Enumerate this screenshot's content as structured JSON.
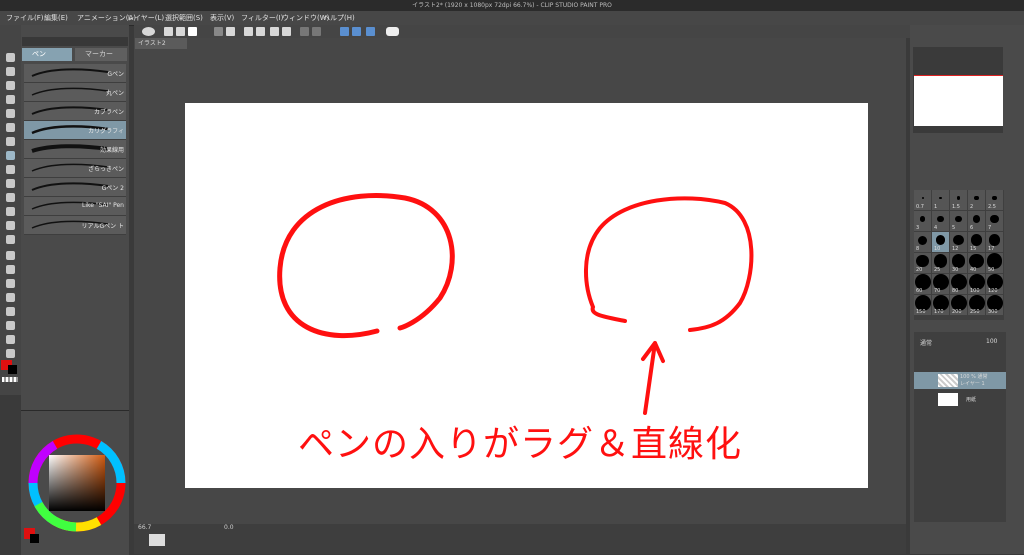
{
  "window": {
    "title": "イラスト2* (1920 x 1080px 72dpi 66.7%) - CLIP STUDIO PAINT PRO"
  },
  "menu": [
    {
      "label": "ファイル(F)"
    },
    {
      "label": "編集(E)"
    },
    {
      "label": "アニメーション(A)"
    },
    {
      "label": "レイヤー(L)"
    },
    {
      "label": "選択範囲(S)"
    },
    {
      "label": "表示(V)"
    },
    {
      "label": "フィルター(I)"
    },
    {
      "label": "ウィンドウ(W)"
    },
    {
      "label": "ヘルプ(H)"
    }
  ],
  "subtool": {
    "tabs": [
      "ペン",
      "マーカー"
    ],
    "brushes": [
      {
        "name": "Gペン"
      },
      {
        "name": "丸ペン"
      },
      {
        "name": "カブラペン"
      },
      {
        "name": "カリグラフィ"
      },
      {
        "name": "効果線用"
      },
      {
        "name": "ざらっきペン"
      },
      {
        "name": "Gペン 2"
      },
      {
        "name": "Like \"SAI\" Pen"
      },
      {
        "name": "リアルGペン ト"
      }
    ],
    "selected_brush": "カリグラフィ"
  },
  "document": {
    "tab": "イラスト2"
  },
  "canvas": {
    "annotation": "ペンの入りがラグ＆直線化",
    "stroke_color": "#ff1010"
  },
  "status": {
    "zoom": "66.7",
    "rotation": "0.0"
  },
  "colors": {
    "main": "#e01010",
    "sub": "#000000",
    "selected_layer": "#7f98a6",
    "accent": "#ff1010"
  },
  "brush_size": {
    "labels": [
      "0.7",
      "1",
      "1.5",
      "2",
      "2.5",
      "3",
      "4",
      "5",
      "6",
      "7",
      "8",
      "10",
      "12",
      "15",
      "17",
      "20",
      "25",
      "30",
      "40",
      "50",
      "60",
      "70",
      "80",
      "100",
      "120",
      "150",
      "170",
      "200",
      "250",
      "300"
    ],
    "selected": "10"
  },
  "layers": {
    "blend": "通常",
    "opacity": "100",
    "items": [
      {
        "name": "100 % 通常\nレイヤー 1"
      },
      {
        "name": "用紙"
      }
    ]
  }
}
